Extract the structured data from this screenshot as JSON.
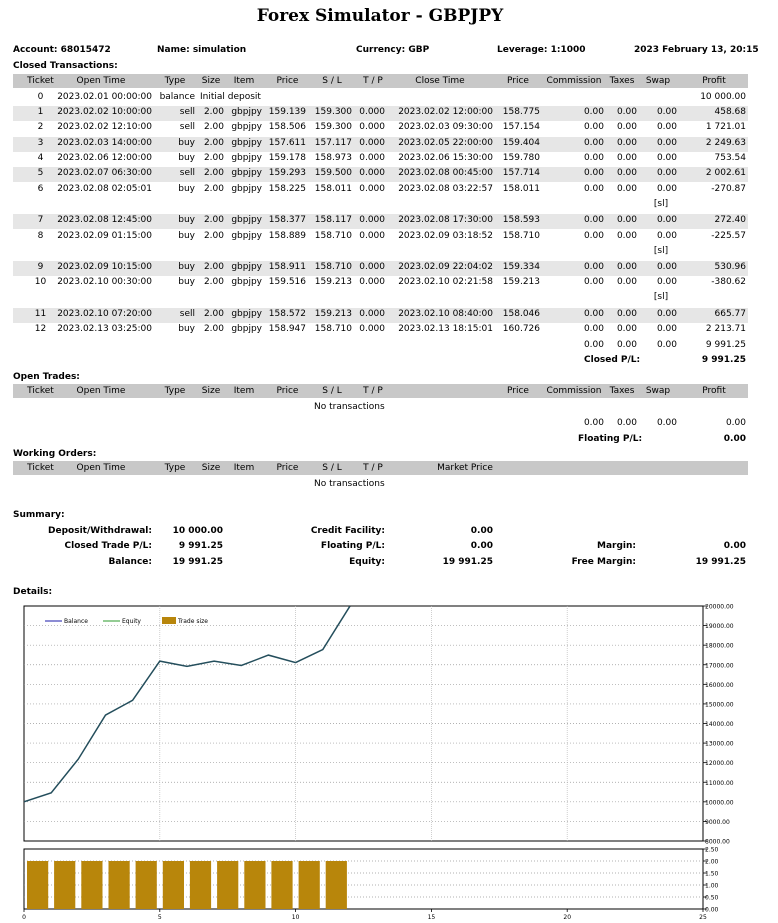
{
  "title": "Forex Simulator - GBPJPY",
  "header": {
    "account": "Account: 68015472",
    "name": "Name: simulation",
    "currency": "Currency: GBP",
    "leverage": "Leverage: 1:1000",
    "datetime": "2023 February 13, 20:15"
  },
  "closed": {
    "heading": "Closed Transactions:",
    "columns": [
      "Ticket",
      "Open Time",
      "Type",
      "Size",
      "Item",
      "Price",
      "S / L",
      "T / P",
      "Close Time",
      "Price",
      "Commission",
      "Taxes",
      "Swap",
      "Profit"
    ],
    "rows": [
      {
        "ticket": "0",
        "open": "2023.02.01 00:00:00",
        "type": "balance",
        "size": "Initial deposit",
        "item": "",
        "price": "",
        "sl": "",
        "tp": "",
        "close": "",
        "cprice": "",
        "comm": "",
        "taxes": "",
        "swap": "",
        "profit": "10 000.00",
        "note": ""
      },
      {
        "ticket": "1",
        "open": "2023.02.02 10:00:00",
        "type": "sell",
        "size": "2.00",
        "item": "gbpjpy",
        "price": "159.139",
        "sl": "159.300",
        "tp": "0.000",
        "close": "2023.02.02 12:00:00",
        "cprice": "158.775",
        "comm": "0.00",
        "taxes": "0.00",
        "swap": "0.00",
        "profit": "458.68",
        "note": ""
      },
      {
        "ticket": "2",
        "open": "2023.02.02 12:10:00",
        "type": "sell",
        "size": "2.00",
        "item": "gbpjpy",
        "price": "158.506",
        "sl": "159.300",
        "tp": "0.000",
        "close": "2023.02.03 09:30:00",
        "cprice": "157.154",
        "comm": "0.00",
        "taxes": "0.00",
        "swap": "0.00",
        "profit": "1 721.01",
        "note": ""
      },
      {
        "ticket": "3",
        "open": "2023.02.03 14:00:00",
        "type": "buy",
        "size": "2.00",
        "item": "gbpjpy",
        "price": "157.611",
        "sl": "157.117",
        "tp": "0.000",
        "close": "2023.02.05 22:00:00",
        "cprice": "159.404",
        "comm": "0.00",
        "taxes": "0.00",
        "swap": "0.00",
        "profit": "2 249.63",
        "note": ""
      },
      {
        "ticket": "4",
        "open": "2023.02.06 12:00:00",
        "type": "buy",
        "size": "2.00",
        "item": "gbpjpy",
        "price": "159.178",
        "sl": "158.973",
        "tp": "0.000",
        "close": "2023.02.06 15:30:00",
        "cprice": "159.780",
        "comm": "0.00",
        "taxes": "0.00",
        "swap": "0.00",
        "profit": "753.54",
        "note": ""
      },
      {
        "ticket": "5",
        "open": "2023.02.07 06:30:00",
        "type": "sell",
        "size": "2.00",
        "item": "gbpjpy",
        "price": "159.293",
        "sl": "159.500",
        "tp": "0.000",
        "close": "2023.02.08 00:45:00",
        "cprice": "157.714",
        "comm": "0.00",
        "taxes": "0.00",
        "swap": "0.00",
        "profit": "2 002.61",
        "note": ""
      },
      {
        "ticket": "6",
        "open": "2023.02.08 02:05:01",
        "type": "buy",
        "size": "2.00",
        "item": "gbpjpy",
        "price": "158.225",
        "sl": "158.011",
        "tp": "0.000",
        "close": "2023.02.08 03:22:57",
        "cprice": "158.011",
        "comm": "0.00",
        "taxes": "0.00",
        "swap": "0.00",
        "profit": "-270.87",
        "note": "[sl]"
      },
      {
        "ticket": "7",
        "open": "2023.02.08 12:45:00",
        "type": "buy",
        "size": "2.00",
        "item": "gbpjpy",
        "price": "158.377",
        "sl": "158.117",
        "tp": "0.000",
        "close": "2023.02.08 17:30:00",
        "cprice": "158.593",
        "comm": "0.00",
        "taxes": "0.00",
        "swap": "0.00",
        "profit": "272.40",
        "note": ""
      },
      {
        "ticket": "8",
        "open": "2023.02.09 01:15:00",
        "type": "buy",
        "size": "2.00",
        "item": "gbpjpy",
        "price": "158.889",
        "sl": "158.710",
        "tp": "0.000",
        "close": "2023.02.09 03:18:52",
        "cprice": "158.710",
        "comm": "0.00",
        "taxes": "0.00",
        "swap": "0.00",
        "profit": "-225.57",
        "note": "[sl]"
      },
      {
        "ticket": "9",
        "open": "2023.02.09 10:15:00",
        "type": "buy",
        "size": "2.00",
        "item": "gbpjpy",
        "price": "158.911",
        "sl": "158.710",
        "tp": "0.000",
        "close": "2023.02.09 22:04:02",
        "cprice": "159.334",
        "comm": "0.00",
        "taxes": "0.00",
        "swap": "0.00",
        "profit": "530.96",
        "note": ""
      },
      {
        "ticket": "10",
        "open": "2023.02.10 00:30:00",
        "type": "buy",
        "size": "2.00",
        "item": "gbpjpy",
        "price": "159.516",
        "sl": "159.213",
        "tp": "0.000",
        "close": "2023.02.10 02:21:58",
        "cprice": "159.213",
        "comm": "0.00",
        "taxes": "0.00",
        "swap": "0.00",
        "profit": "-380.62",
        "note": "[sl]"
      },
      {
        "ticket": "11",
        "open": "2023.02.10 07:20:00",
        "type": "sell",
        "size": "2.00",
        "item": "gbpjpy",
        "price": "158.572",
        "sl": "159.213",
        "tp": "0.000",
        "close": "2023.02.10 08:40:00",
        "cprice": "158.046",
        "comm": "0.00",
        "taxes": "0.00",
        "swap": "0.00",
        "profit": "665.77",
        "note": ""
      },
      {
        "ticket": "12",
        "open": "2023.02.13 03:25:00",
        "type": "buy",
        "size": "2.00",
        "item": "gbpjpy",
        "price": "158.947",
        "sl": "158.710",
        "tp": "0.000",
        "close": "2023.02.13 18:15:01",
        "cprice": "160.726",
        "comm": "0.00",
        "taxes": "0.00",
        "swap": "0.00",
        "profit": "2 213.71",
        "note": ""
      }
    ],
    "totals": {
      "comm": "0.00",
      "taxes": "0.00",
      "swap": "0.00",
      "profit": "9 991.25",
      "label": "Closed P/L:",
      "value": "9 991.25"
    }
  },
  "open": {
    "heading": "Open Trades:",
    "columns": [
      "Ticket",
      "Open Time",
      "Type",
      "Size",
      "Item",
      "Price",
      "S / L",
      "T / P",
      "Price",
      "Commission",
      "Taxes",
      "Swap",
      "Profit"
    ],
    "empty": "No transactions",
    "totals": {
      "comm": "0.00",
      "taxes": "0.00",
      "swap": "0.00",
      "profit": "0.00",
      "label": "Floating P/L:",
      "value": "0.00"
    }
  },
  "working": {
    "heading": "Working Orders:",
    "columns": [
      "Ticket",
      "Open Time",
      "Type",
      "Size",
      "Item",
      "Price",
      "S / L",
      "T / P",
      "Market Price"
    ],
    "empty": "No transactions"
  },
  "summary": {
    "heading": "Summary:",
    "deposit_label": "Deposit/Withdrawal:",
    "deposit": "10 000.00",
    "closed_label": "Closed Trade P/L:",
    "closed": "9 991.25",
    "balance_label": "Balance:",
    "balance": "19 991.25",
    "credit_label": "Credit Facility:",
    "credit": "0.00",
    "floating_label": "Floating P/L:",
    "floating": "0.00",
    "equity_label": "Equity:",
    "equity": "19 991.25",
    "margin_label": "Margin:",
    "margin": "0.00",
    "free_label": "Free Margin:",
    "free": "19 991.25"
  },
  "details_heading": "Details:",
  "chart_data": {
    "type": "line",
    "legend": [
      "Balance",
      "Equity",
      "Trade size"
    ],
    "legend_placement": "top-left",
    "colors": {
      "balance": "#1a1aa8",
      "equity": "#2a9a2a",
      "line": "#244e5c",
      "bars": "#b8860b"
    },
    "x": [
      0,
      1,
      2,
      3,
      4,
      5,
      6,
      7,
      8,
      9,
      10,
      11,
      12
    ],
    "series": [
      {
        "name": "Balance",
        "values": [
          10000,
          10458.68,
          12179.69,
          14429.32,
          15182.86,
          17185.47,
          16914.6,
          17187.0,
          16961.43,
          17492.39,
          17111.77,
          17777.54,
          19991.25
        ]
      }
    ],
    "trade_size": [
      2,
      2,
      2,
      2,
      2,
      2,
      2,
      2,
      2,
      2,
      2,
      2
    ],
    "xlim": [
      0,
      25
    ],
    "ylim": [
      8000,
      20000
    ],
    "bar_ylim": [
      0,
      2.5
    ],
    "x_ticks": [
      "0",
      "5",
      "10",
      "15",
      "20",
      "25"
    ],
    "y_ticks": [
      "20000.00",
      "19000.00",
      "18000.00",
      "17000.00",
      "16000.00",
      "15000.00",
      "14000.00",
      "13000.00",
      "12000.00",
      "11000.00",
      "10000.00",
      "9000.00",
      "8000.00"
    ],
    "bar_ticks": [
      "2.50",
      "2.00",
      "1.50",
      "1.00",
      "0.50",
      "0.00"
    ],
    "grid": true
  }
}
